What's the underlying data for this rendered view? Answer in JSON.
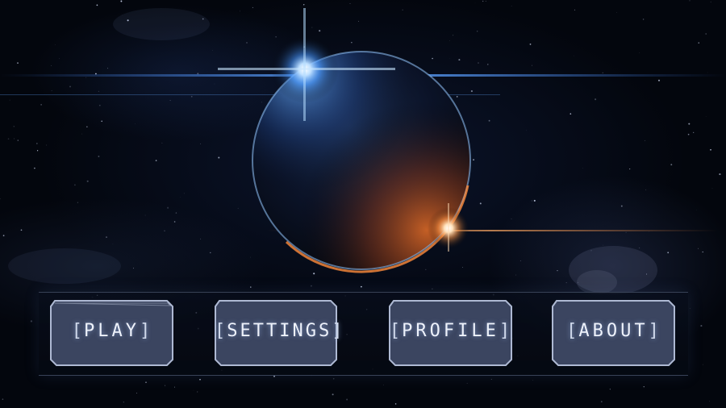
{
  "menu": {
    "buttons": [
      {
        "id": "play",
        "label": "PLAY"
      },
      {
        "id": "settings",
        "label": "SETTINGS"
      },
      {
        "id": "profile",
        "label": "PROFILE"
      },
      {
        "id": "about",
        "label": "ABOUT"
      }
    ]
  },
  "colors": {
    "button_fill": "#3b4560",
    "button_border": "#aeb9d3",
    "label_text": "#eef2fb",
    "flare_blue": "#6fb2ff",
    "flare_orange": "#ffb46a"
  },
  "icons": [
    "planet-icon",
    "blue-flare-icon",
    "orange-flare-icon"
  ]
}
